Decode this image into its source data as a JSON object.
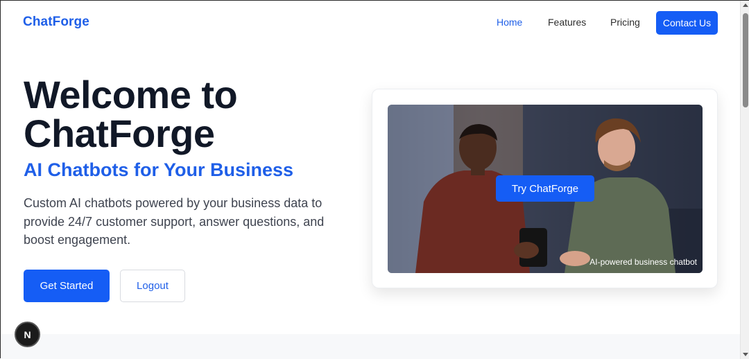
{
  "brand": "ChatForge",
  "nav": {
    "items": [
      "Home",
      "Features",
      "Pricing"
    ],
    "cta": "Contact Us"
  },
  "hero": {
    "title_line1": "Welcome to",
    "title_line2": "ChatForge",
    "subtitle": "AI Chatbots for Your Business",
    "description": "Custom AI chatbots powered by your business data to provide 24/7 customer support, answer questions, and boost engagement.",
    "primary_button": "Get Started",
    "secondary_button": "Logout"
  },
  "card": {
    "button": "Try ChatForge",
    "caption": "AI-powered business chatbot"
  },
  "dev_badge": "N",
  "colors": {
    "accent": "#155df5",
    "brand_text": "#1f5fe8",
    "heading": "#111827"
  }
}
